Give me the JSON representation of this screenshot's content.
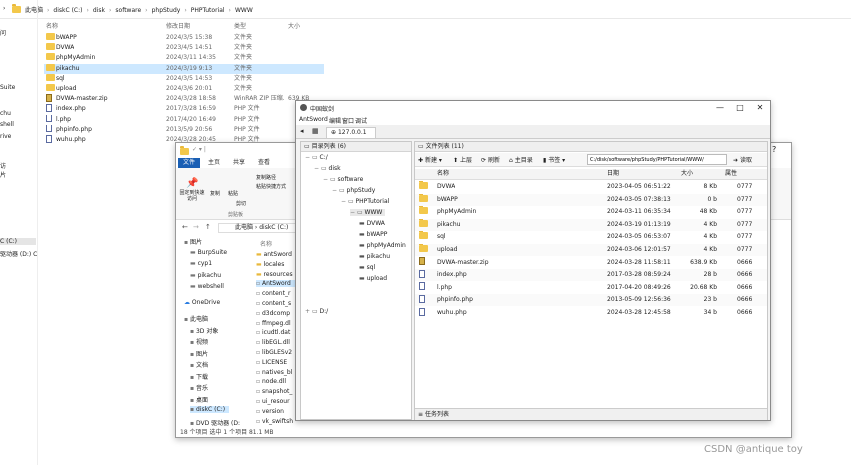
{
  "bg": {
    "breadcrumb": [
      "此电脑",
      "diskC (C:)",
      "disk",
      "software",
      "phpStudy",
      "PHPTutorial",
      "WWW"
    ],
    "headers": {
      "name": "名称",
      "date": "修改日期",
      "type": "类型",
      "size": "大小"
    },
    "rows": [
      {
        "name": "bWAPP",
        "date": "2024/3/5 15:38",
        "type": "文件夹",
        "size": "",
        "kind": "folder"
      },
      {
        "name": "DVWA",
        "date": "2023/4/5 14:51",
        "type": "文件夹",
        "size": "",
        "kind": "folder"
      },
      {
        "name": "phpMyAdmin",
        "date": "2024/3/11 14:35",
        "type": "文件夹",
        "size": "",
        "kind": "folder"
      },
      {
        "name": "pikachu",
        "date": "2024/3/19 9:13",
        "type": "文件夹",
        "size": "",
        "kind": "folder"
      },
      {
        "name": "sql",
        "date": "2024/3/5 14:53",
        "type": "文件夹",
        "size": "",
        "kind": "folder"
      },
      {
        "name": "upload",
        "date": "2024/3/6 20:01",
        "type": "文件夹",
        "size": "",
        "kind": "folder"
      },
      {
        "name": "DVWA-master.zip",
        "date": "2024/3/28 18:58",
        "type": "WinRAR ZIP 压缩...",
        "size": "639 KB",
        "kind": "zip"
      },
      {
        "name": "index.php",
        "date": "2017/3/28 16:59",
        "type": "PHP 文件",
        "size": "",
        "kind": "php"
      },
      {
        "name": "l.php",
        "date": "2017/4/20 16:49",
        "type": "PHP 文件",
        "size": "",
        "kind": "php"
      },
      {
        "name": "phpinfo.php",
        "date": "2013/5/9 20:56",
        "type": "PHP 文件",
        "size": "",
        "kind": "php"
      },
      {
        "name": "wuhu.php",
        "date": "2024/3/28 20:45",
        "type": "PHP 文件",
        "size": "",
        "kind": "php"
      }
    ],
    "left_items": [
      "问",
      "Suite",
      "chu",
      "shell",
      "rive",
      "访",
      "片",
      "C (C:)",
      "驱动器 (D:) C"
    ]
  },
  "antsword": {
    "title": "中国蚁剑",
    "menu": [
      "AntSword",
      "编辑",
      "窗口",
      "调试"
    ],
    "tab": "127.0.0.1",
    "dir_header": "目录列表 (6)",
    "files_header": "文件列表 (11)",
    "tree": [
      "C:/",
      "disk",
      "software",
      "phpStudy",
      "PHPTutorial",
      "WWW",
      "DVWA",
      "bWAPP",
      "phpMyAdmin",
      "pikachu",
      "sql",
      "upload",
      "D:/"
    ],
    "toolbar": {
      "new": "新建",
      "up": "上层",
      "refresh": "刷新",
      "home": "主目录",
      "bookmark": "书签",
      "path": "C:/disk/software/phpStudy/PHPTutorial/WWW/",
      "go": "读取"
    },
    "cols": {
      "name": "名称",
      "date": "日期",
      "size": "大小",
      "attr": "属性"
    },
    "files": [
      {
        "name": "DVWA",
        "date": "2023-04-05 06:51:22",
        "size": "8 Kb",
        "attr": "0777",
        "kind": "folder"
      },
      {
        "name": "bWAPP",
        "date": "2024-03-05 07:38:13",
        "size": "0 b",
        "attr": "0777",
        "kind": "folder"
      },
      {
        "name": "phpMyAdmin",
        "date": "2024-03-11 06:35:34",
        "size": "48 Kb",
        "attr": "0777",
        "kind": "folder"
      },
      {
        "name": "pikachu",
        "date": "2024-03-19 01:13:19",
        "size": "4 Kb",
        "attr": "0777",
        "kind": "folder"
      },
      {
        "name": "sql",
        "date": "2024-03-05 06:53:07",
        "size": "4 Kb",
        "attr": "0777",
        "kind": "folder"
      },
      {
        "name": "upload",
        "date": "2024-03-06 12:01:57",
        "size": "4 Kb",
        "attr": "0777",
        "kind": "folder"
      },
      {
        "name": "DVWA-master.zip",
        "date": "2024-03-28 11:58:11",
        "size": "638.9 Kb",
        "attr": "0666",
        "kind": "zip"
      },
      {
        "name": "index.php",
        "date": "2017-03-28 08:59:24",
        "size": "28 b",
        "attr": "0666",
        "kind": "php"
      },
      {
        "name": "l.php",
        "date": "2017-04-20 08:49:26",
        "size": "20.68 Kb",
        "attr": "0666",
        "kind": "php"
      },
      {
        "name": "phpinfo.php",
        "date": "2013-05-09 12:56:36",
        "size": "23 b",
        "attr": "0666",
        "kind": "php"
      },
      {
        "name": "wuhu.php",
        "date": "2024-03-28 12:45:58",
        "size": "34 b",
        "attr": "0666",
        "kind": "php"
      }
    ],
    "task_header": "任务列表"
  },
  "front": {
    "tabs": [
      "文件",
      "主页",
      "共享",
      "查看"
    ],
    "ribbon": [
      "固定到快速访问",
      "复制",
      "粘贴",
      "剪切",
      "复制路径",
      "粘贴快捷方式"
    ],
    "ribbon_group": "剪贴板",
    "breadcrumb": [
      "此电脑",
      "diskC (C:)"
    ],
    "col_name": "名称",
    "nav": [
      "图片",
      "BurpSuite",
      "cyp1",
      "pikachu",
      "webshell",
      "OneDrive",
      "此电脑",
      "3D 对象",
      "视频",
      "图片",
      "文档",
      "下载",
      "音乐",
      "桌面",
      "diskC (C:)",
      "DVD 驱动器 (D:"
    ],
    "files": [
      "antSword",
      "locales",
      "resources",
      "AntSword",
      "content_r",
      "content_s",
      "d3dcomp",
      "ffmpeg.dl",
      "icudtl.dat",
      "libEGL.dll",
      "libGLESv2",
      "LICENSE",
      "natives_bl",
      "node.dll",
      "snapshot_",
      "ui_resour",
      "version",
      "vk_swiftsh"
    ],
    "status": "18 个项目   选中 1 个项目  81.1 MB"
  },
  "watermark": "CSDN @antique toy"
}
